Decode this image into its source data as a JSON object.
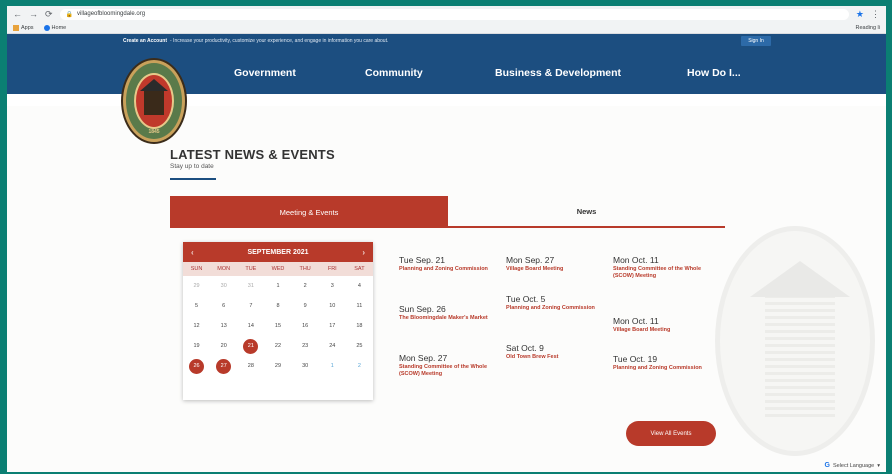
{
  "browser": {
    "url": "villageofbloomingdale.org",
    "bookmarks": [
      "Apps",
      "Home"
    ],
    "bookmarks_right": "Reading li"
  },
  "topbar": {
    "lead": "Create an Account",
    "text": "- Increase your productivity, customize your experience, and engage in information you care about.",
    "signin": "Sign In"
  },
  "seal": {
    "text": "1845"
  },
  "nav": {
    "items": [
      "Government",
      "Community",
      "Business & Development",
      "How Do I..."
    ]
  },
  "section": {
    "title": "LATEST NEWS & EVENTS",
    "subtitle": "Stay up to date"
  },
  "tabs": {
    "meeting": "Meeting & Events",
    "news": "News"
  },
  "calendar": {
    "month": "SEPTEMBER 2021",
    "days": [
      "SUN",
      "MON",
      "TUE",
      "WED",
      "THU",
      "FRI",
      "SAT"
    ],
    "cells": [
      "29",
      "30",
      "31",
      "1",
      "2",
      "3",
      "4",
      "5",
      "6",
      "7",
      "8",
      "9",
      "10",
      "11",
      "12",
      "13",
      "14",
      "15",
      "16",
      "17",
      "18",
      "19",
      "20",
      "21",
      "22",
      "23",
      "24",
      "25",
      "26",
      "27",
      "28",
      "29",
      "30",
      "1",
      "2"
    ]
  },
  "events": [
    {
      "date": "Tue Sep. 21",
      "title": "Planning and Zoning Commission"
    },
    {
      "date": "Sun Sep. 26",
      "title": "The Bloomingdale Maker's Market"
    },
    {
      "date": "Mon Sep. 27",
      "title": "Standing Committee of the Whole (SCOW) Meeting"
    },
    {
      "date": "Mon Sep. 27",
      "title": "Village Board Meeting"
    },
    {
      "date": "Tue Oct. 5",
      "title": "Planning and Zoning Commission"
    },
    {
      "date": "Sat Oct. 9",
      "title": "Old Town Brew Fest"
    },
    {
      "date": "Mon Oct. 11",
      "title": "Standing Committee of the Whole (SCOW) Meeting"
    },
    {
      "date": "Mon Oct. 11",
      "title": "Village Board Meeting"
    },
    {
      "date": "Tue Oct. 19",
      "title": "Planning and Zoning Commission"
    }
  ],
  "view_all": "View All Events",
  "translate": "Select Language"
}
